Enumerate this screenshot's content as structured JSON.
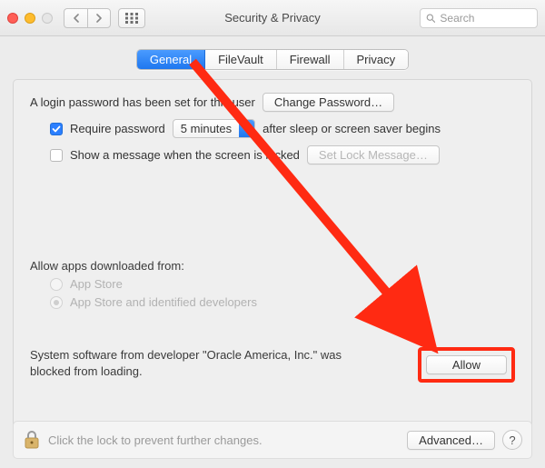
{
  "window": {
    "title": "Security & Privacy",
    "search_placeholder": "Search"
  },
  "tabs": [
    {
      "label": "General",
      "active": true
    },
    {
      "label": "FileVault",
      "active": false
    },
    {
      "label": "Firewall",
      "active": false
    },
    {
      "label": "Privacy",
      "active": false
    }
  ],
  "login": {
    "password_set_text": "A login password has been set for this user",
    "change_password_btn": "Change Password…",
    "require_password_label": "Require password",
    "require_password_checked": true,
    "delay_value": "5 minutes",
    "after_text": "after sleep or screen saver begins",
    "show_message_label": "Show a message when the screen is locked",
    "show_message_checked": false,
    "set_lock_message_btn": "Set Lock Message…"
  },
  "allow_apps": {
    "heading": "Allow apps downloaded from:",
    "options": [
      {
        "label": "App Store",
        "selected": false
      },
      {
        "label": "App Store and identified developers",
        "selected": true
      }
    ]
  },
  "blocked": {
    "text": "System software from developer \"Oracle America, Inc.\" was blocked from loading.",
    "allow_btn": "Allow"
  },
  "footer": {
    "lock_text": "Click the lock to prevent further changes.",
    "advanced_btn": "Advanced…",
    "help_btn": "?"
  },
  "annotation": {
    "color": "#ff2a12"
  }
}
